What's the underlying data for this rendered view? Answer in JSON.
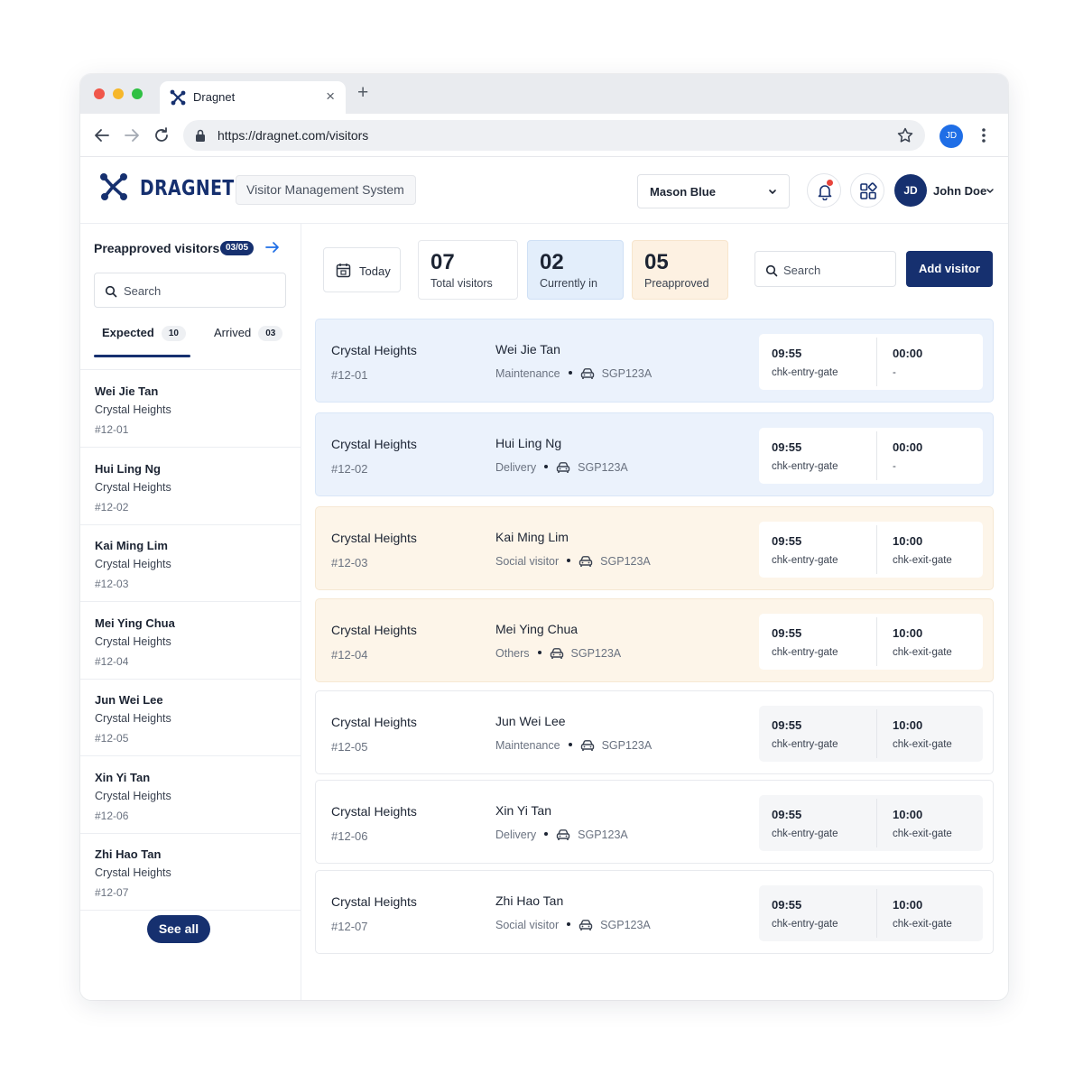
{
  "browser": {
    "tab_title": "Dragnet",
    "url": "https://dragnet.com/visitors",
    "profile_initials": "JD",
    "icons": [
      "back-arrow-icon",
      "forward-arrow-icon",
      "reload-icon",
      "lock-icon",
      "star-icon",
      "kebab-menu-icon",
      "close-icon",
      "plus-icon"
    ]
  },
  "header": {
    "brand": "DRAGNET",
    "system_name": "Visitor Management System",
    "site_select": "Mason Blue",
    "user_initials": "JD",
    "user_name": "John Doe"
  },
  "sidebar": {
    "title": "Preapproved visitors",
    "badge": "03/05",
    "search_placeholder": "Search",
    "tabs": [
      {
        "label": "Expected",
        "count": "10",
        "active": true
      },
      {
        "label": "Arrived",
        "count": "03",
        "active": false
      }
    ],
    "items": [
      {
        "name": "Wei Jie Tan",
        "building": "Crystal Heights",
        "unit": "#12-01"
      },
      {
        "name": "Hui Ling Ng",
        "building": "Crystal Heights",
        "unit": "#12-02"
      },
      {
        "name": "Kai Ming Lim",
        "building": "Crystal Heights",
        "unit": "#12-03"
      },
      {
        "name": "Mei Ying Chua",
        "building": "Crystal Heights",
        "unit": "#12-04"
      },
      {
        "name": "Jun Wei Lee",
        "building": "Crystal Heights",
        "unit": "#12-05"
      },
      {
        "name": "Xin Yi Tan",
        "building": "Crystal Heights",
        "unit": "#12-06"
      },
      {
        "name": "Zhi Hao Tan",
        "building": "Crystal Heights",
        "unit": "#12-07"
      }
    ],
    "see_all": "See all"
  },
  "toolbar": {
    "today": "Today",
    "stats": [
      {
        "value": "07",
        "label": "Total visitors"
      },
      {
        "value": "02",
        "label": "Currently in"
      },
      {
        "value": "05",
        "label": "Preapproved"
      }
    ],
    "search_placeholder": "Search",
    "add_visitor": "Add visitor"
  },
  "visits": [
    {
      "building": "Crystal Heights",
      "unit": "#12-01",
      "name": "Wei Jie Tan",
      "purpose": "Maintenance",
      "plate": "SGP123A",
      "in_time": "09:55",
      "in_gate": "chk-entry-gate",
      "out_time": "00:00",
      "out_gate": "-",
      "status": "in"
    },
    {
      "building": "Crystal Heights",
      "unit": "#12-02",
      "name": "Hui Ling Ng",
      "purpose": "Delivery",
      "plate": "SGP123A",
      "in_time": "09:55",
      "in_gate": "chk-entry-gate",
      "out_time": "00:00",
      "out_gate": "-",
      "status": "in"
    },
    {
      "building": "Crystal Heights",
      "unit": "#12-03",
      "name": "Kai Ming Lim",
      "purpose": "Social visitor",
      "plate": "SGP123A",
      "in_time": "09:55",
      "in_gate": "chk-entry-gate",
      "out_time": "10:00",
      "out_gate": "chk-exit-gate",
      "status": "preapproved"
    },
    {
      "building": "Crystal Heights",
      "unit": "#12-04",
      "name": "Mei Ying Chua",
      "purpose": "Others",
      "plate": "SGP123A",
      "in_time": "09:55",
      "in_gate": "chk-entry-gate",
      "out_time": "10:00",
      "out_gate": "chk-exit-gate",
      "status": "preapproved"
    },
    {
      "building": "Crystal Heights",
      "unit": "#12-05",
      "name": "Jun Wei Lee",
      "purpose": "Maintenance",
      "plate": "SGP123A",
      "in_time": "09:55",
      "in_gate": "chk-entry-gate",
      "out_time": "10:00",
      "out_gate": "chk-exit-gate",
      "status": "out"
    },
    {
      "building": "Crystal Heights",
      "unit": "#12-06",
      "name": "Xin Yi Tan",
      "purpose": "Delivery",
      "plate": "SGP123A",
      "in_time": "09:55",
      "in_gate": "chk-entry-gate",
      "out_time": "10:00",
      "out_gate": "chk-exit-gate",
      "status": "out"
    },
    {
      "building": "Crystal Heights",
      "unit": "#12-07",
      "name": "Zhi Hao Tan",
      "purpose": "Social visitor",
      "plate": "SGP123A",
      "in_time": "09:55",
      "in_gate": "chk-entry-gate",
      "out_time": "10:00",
      "out_gate": "chk-exit-gate",
      "status": "out"
    }
  ],
  "colors": {
    "brand_navy": "#16306f",
    "currently_in_bg": "#ebf2fc",
    "preapproved_bg": "#fdf5e9",
    "notification_dot": "#e8453c",
    "traffic_red": "#f0564a",
    "traffic_yellow": "#f6b72a",
    "traffic_green": "#2fc043"
  }
}
